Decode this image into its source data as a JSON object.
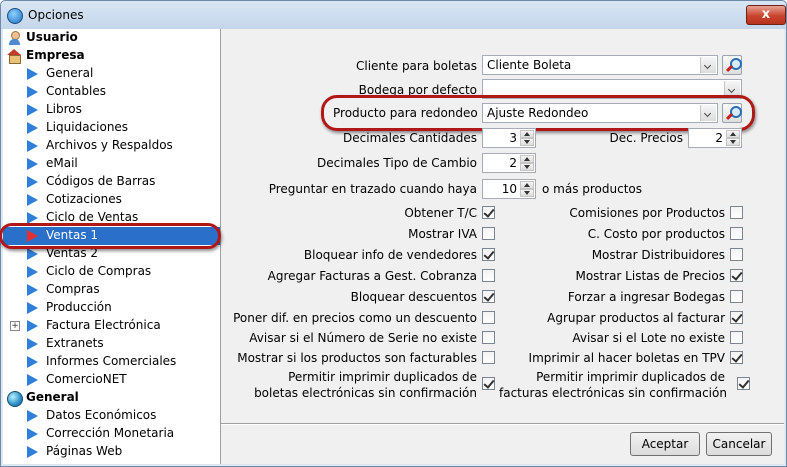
{
  "window": {
    "title": "Opciones",
    "close_glyph": "x"
  },
  "icons": {
    "app": "app-icon",
    "close": "close-icon",
    "search": "search-icon",
    "tree_item": "play-arrow-icon"
  },
  "colors": {
    "selection": "#2a6fc9",
    "tree_arrow": "#2f7fd8",
    "highlight_oval": "#b01818"
  },
  "tree": {
    "group_usuario": "Usuario",
    "group_empresa": "Empresa",
    "empresa_items": [
      "General",
      "Contables",
      "Libros",
      "Liquidaciones",
      "Archivos y Respaldos",
      "eMail",
      "Códigos de Barras",
      "Cotizaciones",
      "Ciclo de Ventas",
      "Ventas 1",
      "Ventas 2",
      "Ciclo de Compras",
      "Compras",
      "Producción",
      "Factura Electrónica",
      "Extranets",
      "Informes Comerciales",
      "ComercioNET"
    ],
    "selected_item": "Ventas 1",
    "expand_glyph": "+",
    "group_general": "General",
    "general_items": [
      "Datos Económicos",
      "Corrección Monetaria",
      "Páginas Web"
    ]
  },
  "form": {
    "cliente_label": "Cliente para boletas",
    "cliente_value": "Cliente Boleta",
    "bodega_label": "Bodega por defecto",
    "bodega_value": "",
    "producto_label": "Producto para redondeo",
    "producto_value": "Ajuste Redondeo",
    "dec_cant_label": "Decimales Cantidades",
    "dec_cant_value": "3",
    "dec_precios_label": "Dec. Precios",
    "dec_precios_value": "2",
    "dec_tc_label": "Decimales Tipo de Cambio",
    "dec_tc_value": "2",
    "preguntar_label": "Preguntar en trazado cuando haya",
    "preguntar_value": "10",
    "preguntar_suffix": "o más productos"
  },
  "checks_left": [
    {
      "label": "Obtener T/C",
      "checked": true
    },
    {
      "label": "Mostrar IVA",
      "checked": false
    },
    {
      "label": "Bloquear info de vendedores",
      "checked": true
    },
    {
      "label": "Agregar Facturas a Gest. Cobranza",
      "checked": false
    },
    {
      "label": "Bloquear descuentos",
      "checked": true
    },
    {
      "label": "Poner dif. en precios como un descuento",
      "checked": false
    },
    {
      "label": "Avisar si el Número de Serie no existe",
      "checked": false
    },
    {
      "label": "Mostrar si los productos son facturables",
      "checked": false
    },
    {
      "label_line1": "Permitir imprimir duplicados de",
      "label_line2": "boletas electrónicas sin confirmación",
      "checked": true
    }
  ],
  "checks_right": [
    {
      "label": "Comisiones por Productos",
      "checked": false
    },
    {
      "label": "C. Costo por productos",
      "checked": false
    },
    {
      "label": "Mostrar Distribuidores",
      "checked": false
    },
    {
      "label": "Mostrar Listas de Precios",
      "checked": true
    },
    {
      "label": "Forzar a ingresar Bodegas",
      "checked": false
    },
    {
      "label": "Agrupar productos al facturar",
      "checked": true
    },
    {
      "label": "Avisar si el Lote no existe",
      "checked": false
    },
    {
      "label": "Imprimir al hacer boletas en TPV",
      "checked": true
    },
    {
      "label_line1": "Permitir imprimir duplicados de",
      "label_line2": "facturas electrónicas sin confirmación",
      "checked": true
    }
  ],
  "buttons": {
    "accept": "Aceptar",
    "cancel": "Cancelar"
  }
}
